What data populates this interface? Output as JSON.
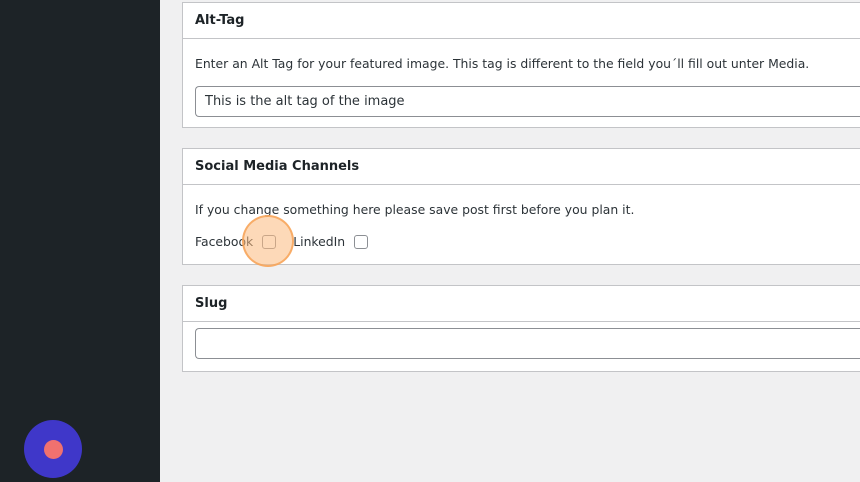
{
  "panels": {
    "alt_tag": {
      "title": "Alt-Tag",
      "description": "Enter an Alt Tag for your featured image. This tag is different to the field you´ll fill out unter Media.",
      "input_value": "This is the alt tag of the image"
    },
    "social": {
      "title": "Social Media Channels",
      "description": "If you change something here please save post first before you plan it.",
      "facebook_label": "Facebook",
      "facebook_checked": false,
      "linkedin_label": "LinkedIn",
      "linkedin_checked": false
    },
    "slug": {
      "title": "Slug",
      "input_value": ""
    }
  },
  "colors": {
    "sidebar": "#1d2327",
    "background": "#f0f0f1",
    "record_button": "#3f37c9",
    "record_dot": "#f0716f",
    "click_highlight": "#fcba7d"
  },
  "icons": {
    "record": "record-icon"
  }
}
